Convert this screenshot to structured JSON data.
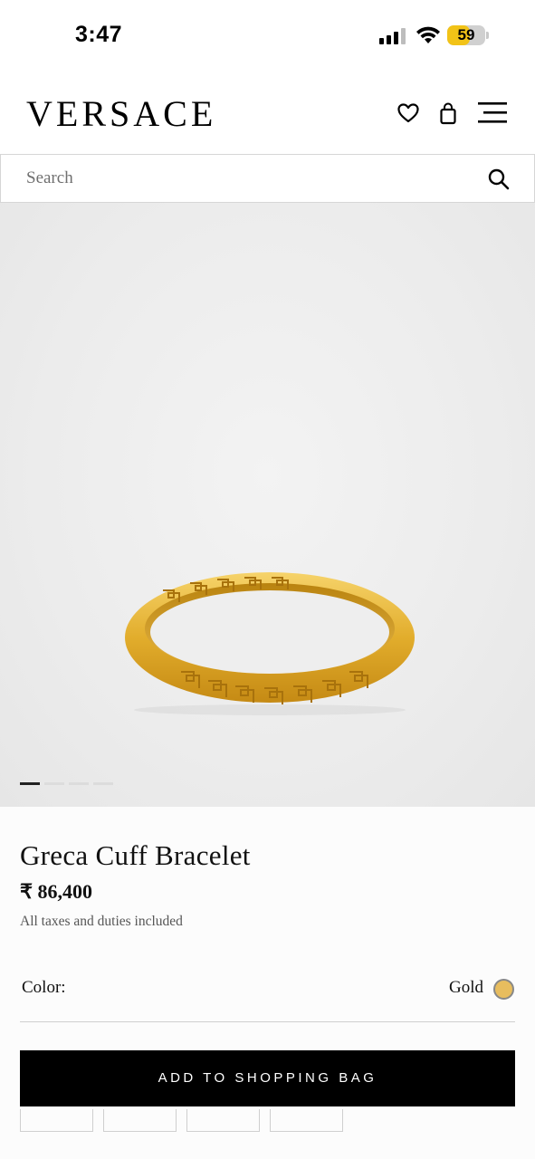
{
  "status_bar": {
    "time": "3:47",
    "battery_level": "59",
    "battery_color": "#f2c317"
  },
  "header": {
    "logo": "VERSACE",
    "icons": [
      "heart-icon",
      "shopping-bag-icon",
      "menu-icon"
    ]
  },
  "search": {
    "placeholder": "Search",
    "icon": "search-icon"
  },
  "gallery": {
    "image_count": 4,
    "active_index": 0
  },
  "product": {
    "name": "Greca Cuff Bracelet",
    "price": "₹ 86,400",
    "tax_note": "All taxes and duties included",
    "color_label": "Color:",
    "color_value": "Gold",
    "color_swatch": "#e8bd5e",
    "add_button_label": "ADD TO SHOPPING BAG"
  }
}
